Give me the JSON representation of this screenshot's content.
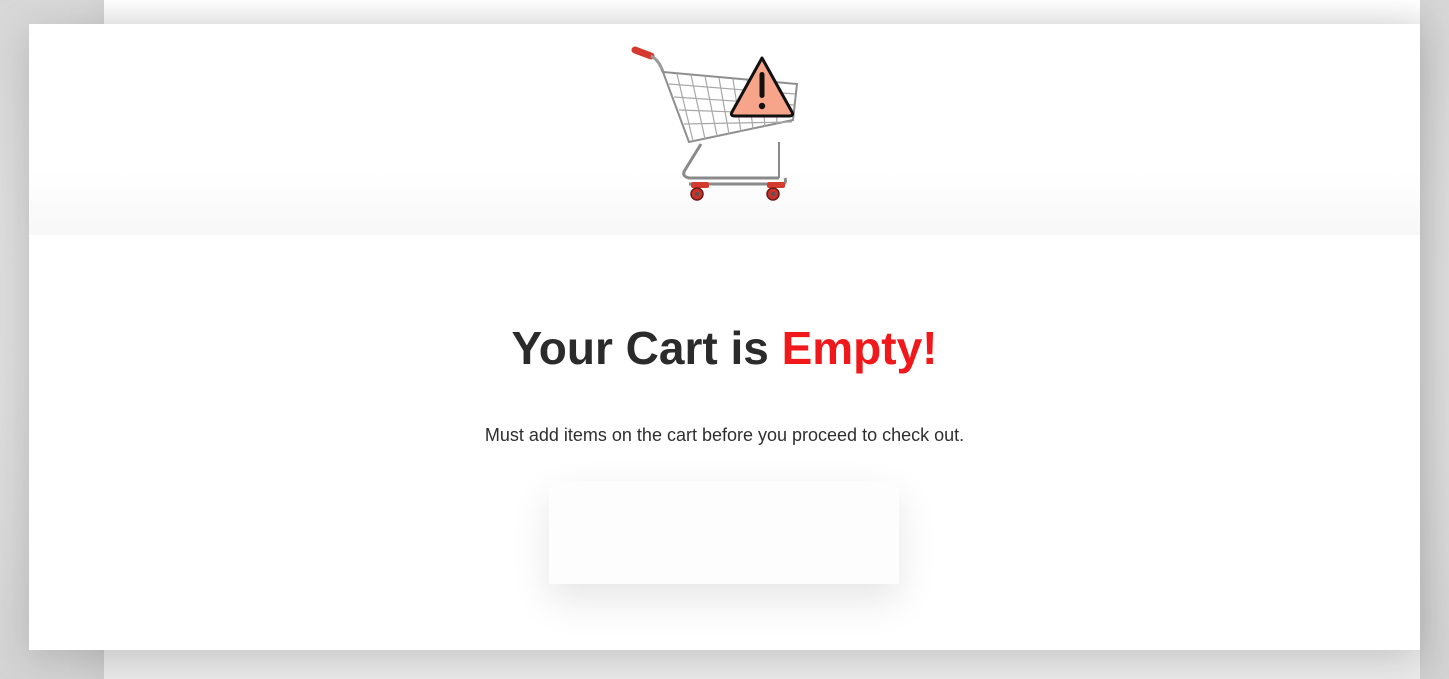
{
  "empty_cart": {
    "title_main": "Your Cart is ",
    "title_accent": "Empty!",
    "message": "Must add items on the cart before you proceed to check out.",
    "button_label": ""
  },
  "colors": {
    "accent": "#f0181a",
    "heading": "#2b2b2b",
    "text": "#2f2f2f",
    "warning_fill": "#f6a48a"
  },
  "icons": {
    "illustration": "shopping-cart-warning-icon"
  }
}
